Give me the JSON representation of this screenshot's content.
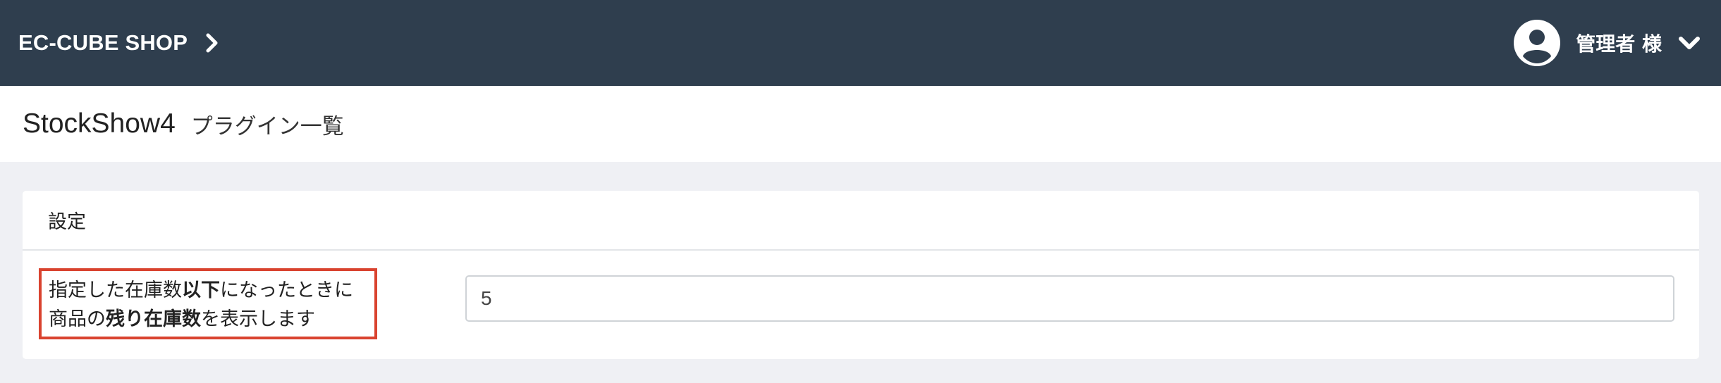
{
  "header": {
    "shop_name": "EC-CUBE SHOP",
    "user_label": "管理者 様",
    "colors": {
      "bar": "#2f3e4e",
      "text": "#ffffff"
    }
  },
  "page": {
    "title": "StockShow4",
    "subtitle": "プラグイン一覧"
  },
  "settings": {
    "card_title": "設定",
    "label": {
      "line1_a": "指定した在庫数",
      "line1_b": "以下",
      "line1_c": "になったときに",
      "line2_a": "商品の",
      "line2_b": "残り在庫数",
      "line2_c": "を表示します"
    },
    "stock_value": "5",
    "highlight_color": "#d9432f"
  },
  "icons": {
    "brand_chevron": "chevron-right-icon",
    "avatar": "user-avatar-icon",
    "user_menu": "chevron-down-icon"
  }
}
